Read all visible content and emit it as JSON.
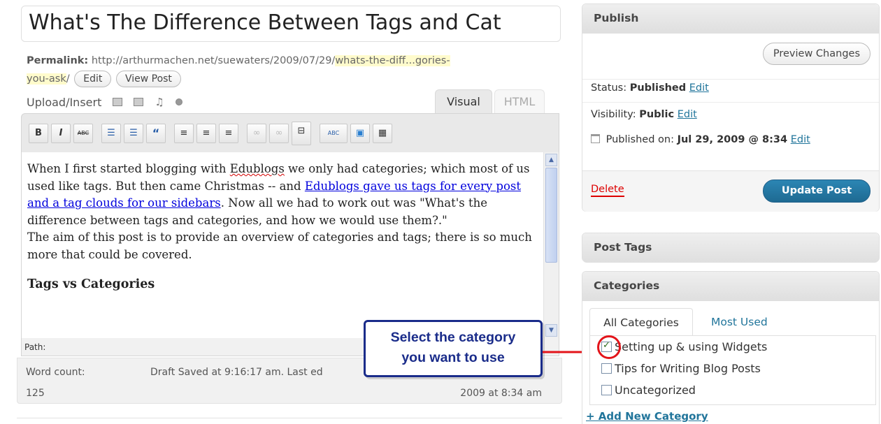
{
  "post": {
    "title": "What's The Difference Between Tags and Cat",
    "permalink_label": "Permalink:",
    "permalink_base": "http://arthurmachen.net/suewaters/2009/07/29/",
    "permalink_slug_1": "whats-the-diff...gories-",
    "permalink_slug_2": "you-ask",
    "permalink_tail": "/",
    "edit_button": "Edit",
    "view_post_button": "View Post"
  },
  "media": {
    "label": "Upload/Insert"
  },
  "editor_tabs": {
    "visual": "Visual",
    "html": "HTML"
  },
  "toolbar": {
    "bold": "B",
    "italic": "I",
    "strike": "ABC",
    "ul": "☰",
    "ol": "☰",
    "quote": "“",
    "align_left": "≡",
    "align_center": "≡",
    "align_right": "≡",
    "link": "∞",
    "unlink": "∞",
    "more": "⊟",
    "spell": "ABC",
    "fullscreen": "▣",
    "kitchen_sink": "▦"
  },
  "content": {
    "p1_a": "When I first started blogging with ",
    "p1_b": "Edublogs",
    "p1_c": " we only had categories; which most of us used like tags. But then came Christmas -- and ",
    "p1_link": "Edublogs gave us tags for every post and a tag clouds for our sidebars",
    "p1_d": ". Now all we had to work out was \"What's the difference between tags and categories, and how we would use them?.\"",
    "p2": "The aim of this post is to provide an overview of categories and tags; there is so much more that could be covered.",
    "h_tags": "Tags vs Categories"
  },
  "status_bar": {
    "path_label": "Path:",
    "word_count_label": "Word count:",
    "word_count": "125",
    "draft_saved": "Draft Saved at 9:16:17 am. Last ed",
    "last_edited_date": "2009 at 8:34 am"
  },
  "callout": {
    "line1": "Select the category",
    "line2": "you want to use"
  },
  "publish": {
    "title": "Publish",
    "preview_button": "Preview Changes",
    "status_label": "Status:",
    "status_value": "Published",
    "visibility_label": "Visibility:",
    "visibility_value": "Public",
    "published_label": "Published on:",
    "published_value": "Jul 29, 2009 @ 8:34",
    "edit_link": "Edit",
    "delete_link": "Delete",
    "update_button": "Update Post"
  },
  "post_tags": {
    "title": "Post Tags"
  },
  "categories": {
    "title": "Categories",
    "tab_all": "All Categories",
    "tab_most_used": "Most Used",
    "items": [
      {
        "label": "Setting up & using Widgets",
        "checked": true
      },
      {
        "label": "Tips for Writing Blog Posts",
        "checked": false
      },
      {
        "label": "Uncategorized",
        "checked": false
      }
    ],
    "add_new": "+ Add New Category"
  },
  "colors": {
    "link": "#21759b",
    "callout": "#1a2c8a",
    "highlight_ring": "#e3141a",
    "primary_button": "#21759b"
  }
}
